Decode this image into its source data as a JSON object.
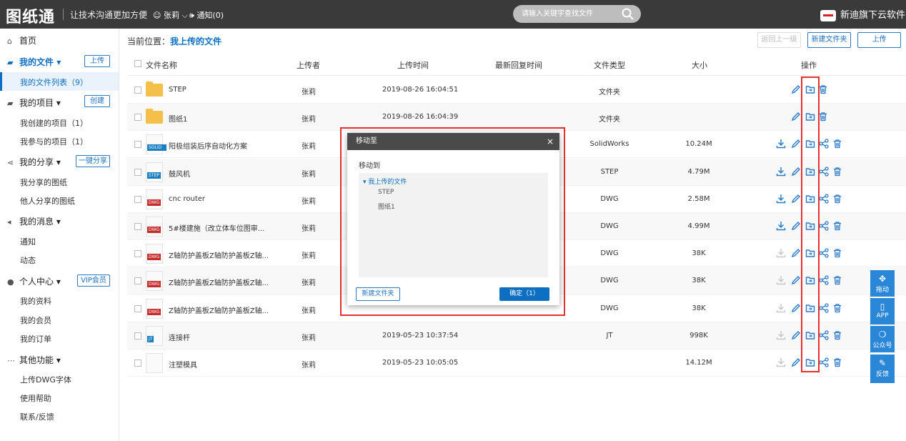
{
  "header": {
    "logo": "图纸通",
    "slogan": "让技术沟通更加方便",
    "user": "张莉",
    "notice": "通知(0)",
    "search_placeholder": "请输入关键字查找文件",
    "brand": "新迪旗下云软件"
  },
  "sidebar": {
    "home": "首页",
    "my_files": "我的文件",
    "upload_btn": "上传",
    "file_list": "我的文件列表（9）",
    "my_projects": "我的项目",
    "create_btn": "创建",
    "created_projects": "我创建的项目（1）",
    "joined_projects": "我参与的项目（1）",
    "my_share": "我的分享",
    "share_btn": "一键分享",
    "my_shared": "我分享的图纸",
    "others_shared": "他人分享的图纸",
    "my_messages": "我的消息",
    "notify": "通知",
    "dynamic": "动态",
    "personal": "个人中心",
    "vip_btn": "VIP会员",
    "my_profile": "我的资料",
    "my_member": "我的会员",
    "my_orders": "我的订单",
    "other": "其他功能",
    "upload_font": "上传DWG字体",
    "help": "使用帮助",
    "contact": "联系/反馈"
  },
  "toolbar": {
    "crumb_label": "当前位置：",
    "crumb_value": "我上传的文件",
    "back": "返回上一级",
    "new_folder": "新建文件夹",
    "upload": "上传"
  },
  "table": {
    "headers": [
      "文件名称",
      "上传者",
      "上传时间",
      "最新回复时间",
      "文件类型",
      "大小",
      "操作"
    ],
    "rows": [
      {
        "name": "STEP",
        "uploader": "张莉",
        "time": "2019-08-26 16:04:51",
        "type": "文件夹",
        "size": "",
        "icon": "folder",
        "tag": ""
      },
      {
        "name": "图纸1",
        "uploader": "张莉",
        "time": "2019-08-26 16:04:39",
        "type": "文件夹",
        "size": "",
        "icon": "folder",
        "tag": ""
      },
      {
        "name": "阳极组装后序自动化方案",
        "uploader": "张莉",
        "time": "",
        "type": "SolidWorks",
        "size": "10.24M",
        "icon": "doc",
        "tag": "SOLID WORKS"
      },
      {
        "name": "鼓风机",
        "uploader": "张莉",
        "time": "",
        "type": "STEP",
        "size": "4.79M",
        "icon": "doc",
        "tag": "STEP"
      },
      {
        "name": "cnc router",
        "uploader": "张莉",
        "time": "",
        "type": "DWG",
        "size": "2.58M",
        "icon": "doc",
        "tag": "DWG"
      },
      {
        "name": "5#楼建施（改立体车位图审...",
        "uploader": "张莉",
        "time": "",
        "type": "DWG",
        "size": "4.99M",
        "icon": "doc",
        "tag": "DWG"
      },
      {
        "name": "Z轴防护盖板Z轴防护盖板Z轴...",
        "uploader": "张莉",
        "time": "",
        "type": "DWG",
        "size": "38K",
        "icon": "doc",
        "tag": "DWG"
      },
      {
        "name": "Z轴防护盖板Z轴防护盖板Z轴...",
        "uploader": "张莉",
        "time": "",
        "type": "DWG",
        "size": "38K",
        "icon": "doc",
        "tag": "DWG"
      },
      {
        "name": "Z轴防护盖板Z轴防护盖板Z轴...",
        "uploader": "张莉",
        "time": "",
        "type": "DWG",
        "size": "38K",
        "icon": "doc",
        "tag": "DWG"
      },
      {
        "name": "连接杆",
        "uploader": "张莉",
        "time": "2019-05-23 10:37:54",
        "type": "JT",
        "size": "998K",
        "icon": "doc",
        "tag": "JT"
      },
      {
        "name": "注塑模具",
        "uploader": "张莉",
        "time": "2019-05-23 10:05:05",
        "type": "",
        "size": "14.12M",
        "icon": "doc",
        "tag": ""
      }
    ]
  },
  "dialog": {
    "title": "移动至",
    "close": "×",
    "label": "移动到",
    "root": "我上传的文件",
    "children": [
      "STEP",
      "图纸1"
    ],
    "new_folder": "新建文件夹",
    "confirm": "确定（1）"
  },
  "float": {
    "drag": "拖动",
    "app": "APP",
    "wechat": "公众号",
    "feedback": "反馈"
  },
  "colors": {
    "accent": "#0c6fc1",
    "highlight": "#e5312f",
    "topbar": "#3a3a3a"
  }
}
